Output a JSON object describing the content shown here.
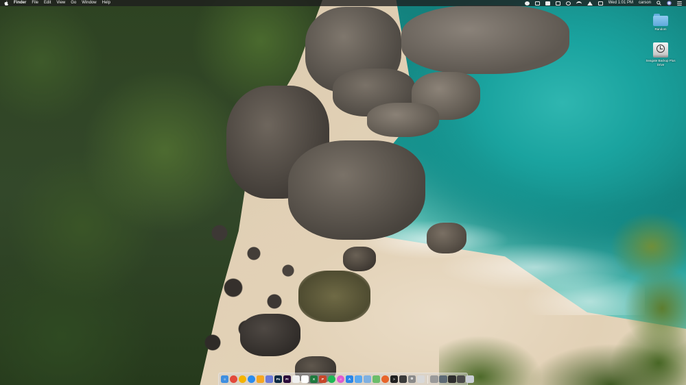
{
  "menubar": {
    "app_name": "Finder",
    "menus": [
      "File",
      "Edit",
      "View",
      "Go",
      "Window",
      "Help"
    ],
    "clock": "Wed 1:01 PM",
    "user": "carson",
    "status_icons": [
      "screen-record-icon",
      "dropbox-icon",
      "grid-icon",
      "airplay-icon",
      "time-machine-icon",
      "wifi-icon",
      "volume-icon",
      "display-icon"
    ]
  },
  "desktop": {
    "icons": [
      {
        "label": "Random",
        "kind": "folder-icon"
      },
      {
        "label": "Seagate Backup Plus Drive",
        "kind": "external-drive-icon"
      }
    ]
  },
  "dock": {
    "apps": [
      {
        "name": "finder-icon",
        "color": "#3f8fe0",
        "glyph": "☺"
      },
      {
        "name": "chrome-icon",
        "color": "#e3493b",
        "glyph": ""
      },
      {
        "name": "chrome-canary-icon",
        "color": "#f4b400",
        "glyph": ""
      },
      {
        "name": "messenger-icon",
        "color": "#2a8cf0",
        "glyph": ""
      },
      {
        "name": "sketch-icon",
        "color": "#f7a721",
        "glyph": ""
      },
      {
        "name": "discord-icon",
        "color": "#6b7ad8",
        "glyph": ""
      },
      {
        "name": "photoshop-icon",
        "color": "#0b2942",
        "glyph": "Ps"
      },
      {
        "name": "premiere-icon",
        "color": "#2a0a3a",
        "glyph": "Pr"
      },
      {
        "name": "photos-icon",
        "color": "#f0f0f0",
        "glyph": ""
      },
      {
        "name": "calendar-icon",
        "color": "#ffffff",
        "glyph": ""
      },
      {
        "name": "excel-icon",
        "color": "#1f7a3f",
        "glyph": "X"
      },
      {
        "name": "powerpoint-icon",
        "color": "#c8462a",
        "glyph": "P"
      },
      {
        "name": "spotify-icon",
        "color": "#1db954",
        "glyph": ""
      },
      {
        "name": "itunes-icon",
        "color": "#e05ad0",
        "glyph": "♫"
      },
      {
        "name": "app-store-icon",
        "color": "#2a86e8",
        "glyph": "A"
      },
      {
        "name": "mail-icon",
        "color": "#5aa8ef",
        "glyph": ""
      },
      {
        "name": "preview-icon",
        "color": "#7fb0e0",
        "glyph": ""
      },
      {
        "name": "maps-icon",
        "color": "#6bbd6a",
        "glyph": ""
      },
      {
        "name": "firefox-icon",
        "color": "#e8642a",
        "glyph": ""
      },
      {
        "name": "terminal-icon",
        "color": "#202020",
        "glyph": ">"
      },
      {
        "name": "activity-monitor-icon",
        "color": "#3a3a3a",
        "glyph": ""
      },
      {
        "name": "system-preferences-icon",
        "color": "#8a8a8a",
        "glyph": "⚙"
      },
      {
        "name": "quicktime-icon",
        "color": "#d8d8d8",
        "glyph": ""
      }
    ],
    "stacks": [
      {
        "name": "screenshot-stack-icon",
        "color": "#9a9a9a"
      },
      {
        "name": "downloads-stack-icon",
        "color": "#5d6a75"
      },
      {
        "name": "desktop-stack-icon",
        "color": "#2d2d2d"
      },
      {
        "name": "documents-stack-icon",
        "color": "#4a4a4a"
      },
      {
        "name": "trash-icon",
        "color": "#c9ced4"
      }
    ]
  }
}
